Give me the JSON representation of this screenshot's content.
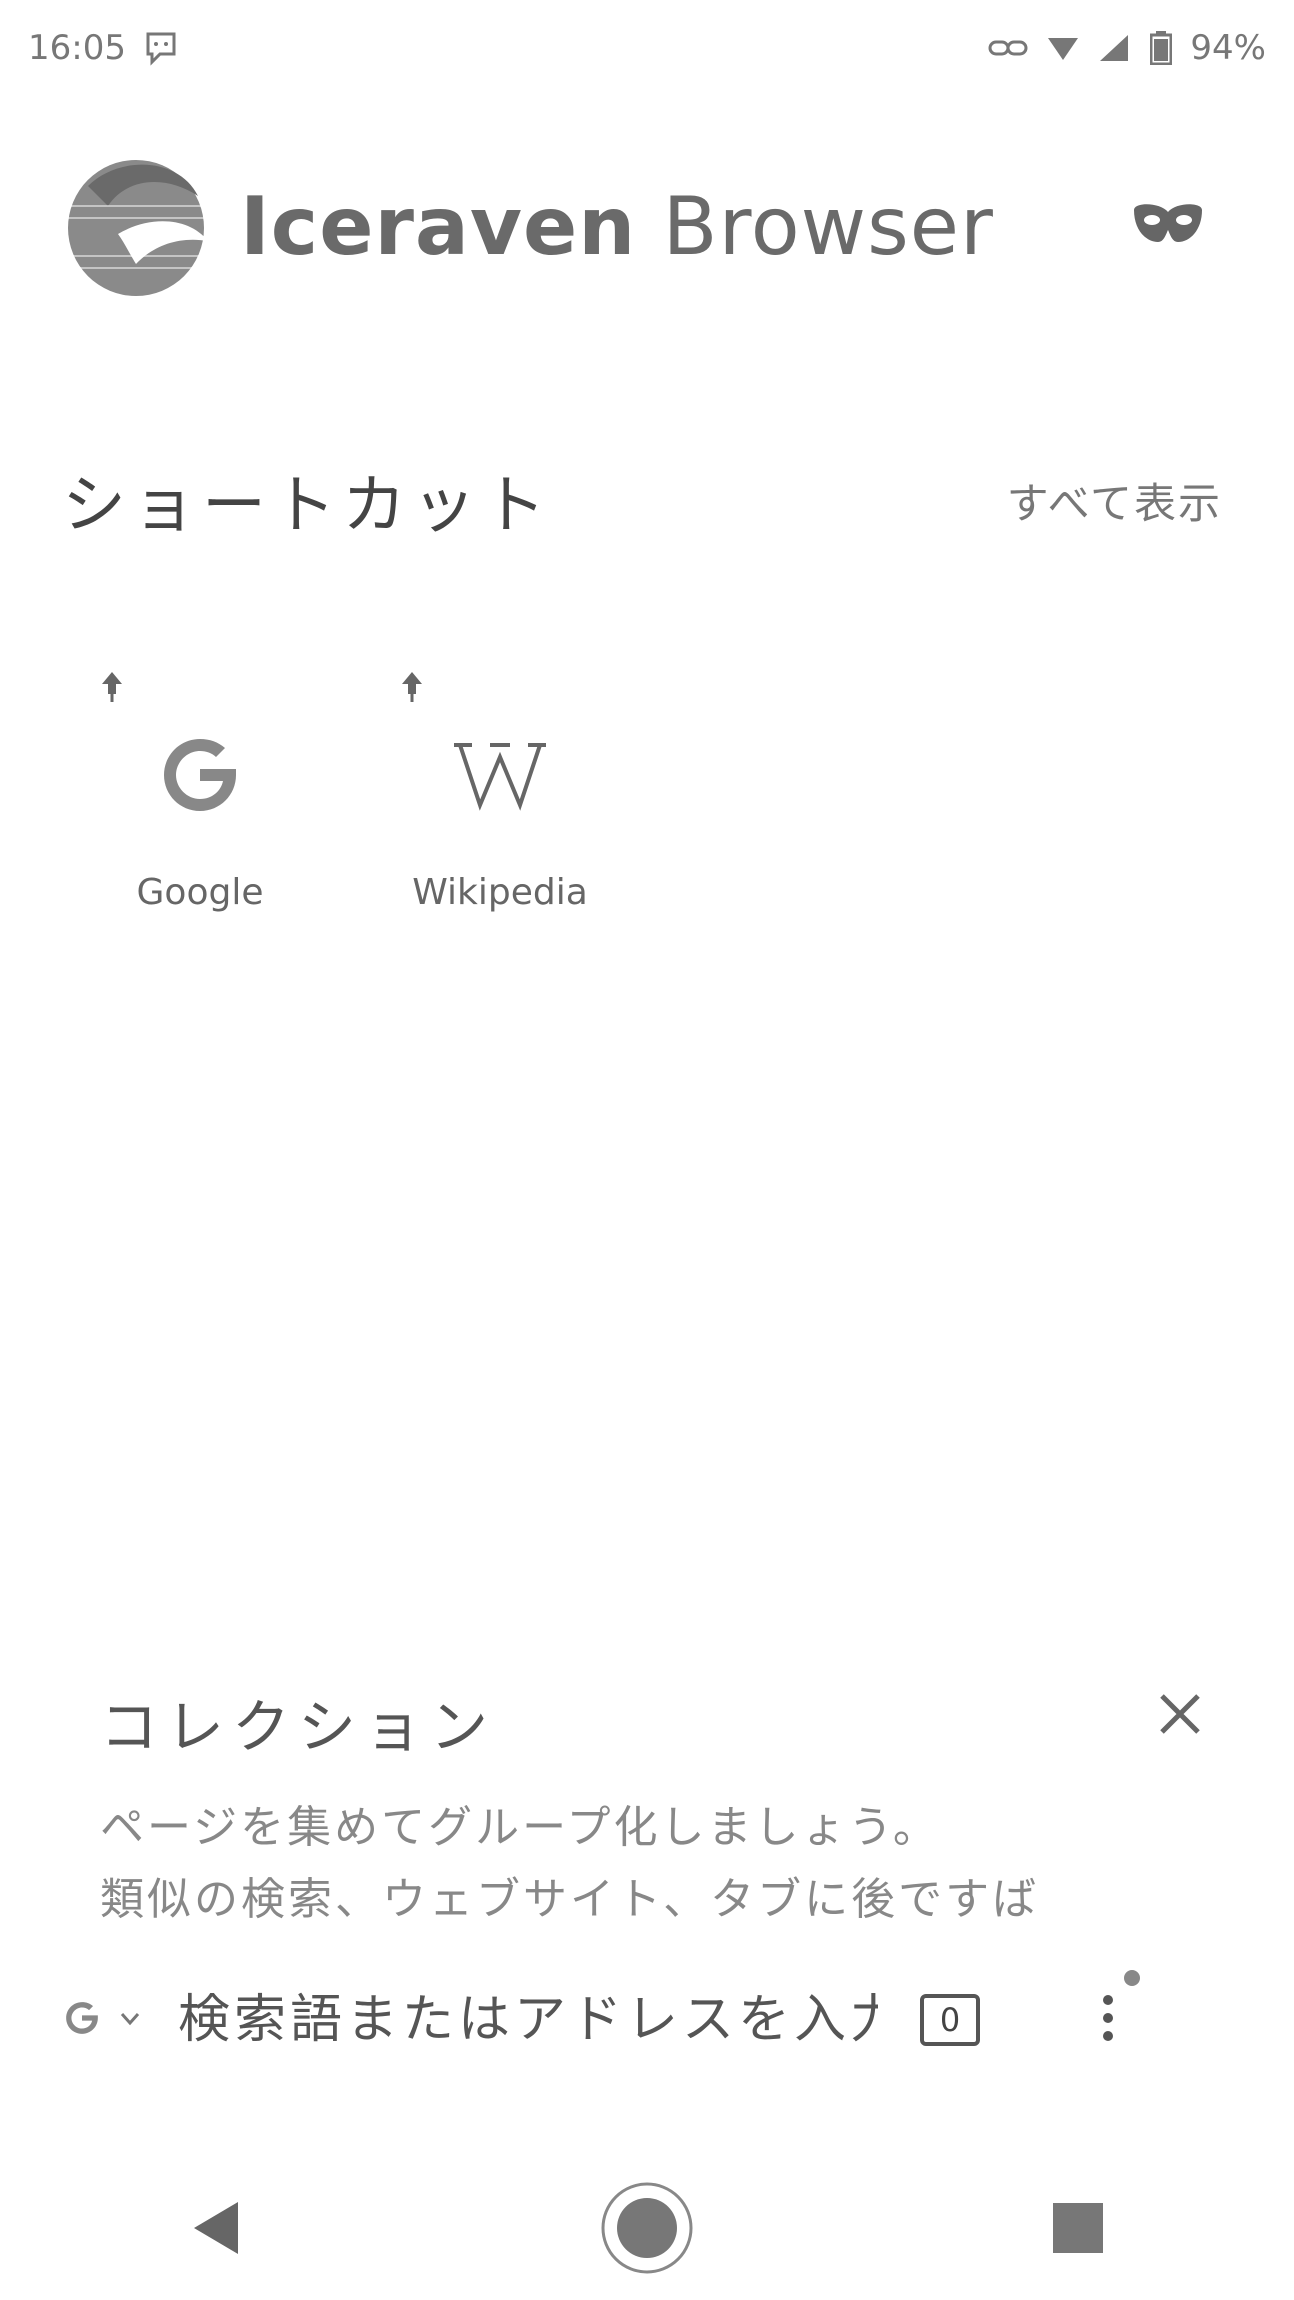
{
  "status_bar": {
    "time": "16:05",
    "battery_percent": "94%"
  },
  "app": {
    "brand_bold": "Iceraven",
    "brand_light": " Browser",
    "private_mode_icon": "mask-icon"
  },
  "shortcuts": {
    "title": "ショートカット",
    "show_all": "すべて表示",
    "items": [
      {
        "label": "Google",
        "icon": "google-icon"
      },
      {
        "label": "Wikipedia",
        "icon": "wikipedia-icon"
      }
    ]
  },
  "collections": {
    "title": "コレクション",
    "description_line1": "ページを集めてグループ化しましょう。",
    "description_line2": "類似の検索、ウェブサイト、タブに後ですば"
  },
  "toolbar": {
    "placeholder": "検索語またはアドレスを入力",
    "tab_count": "0"
  },
  "colors": {
    "text": "#555555",
    "muted": "#888888",
    "background": "#ffffff"
  }
}
